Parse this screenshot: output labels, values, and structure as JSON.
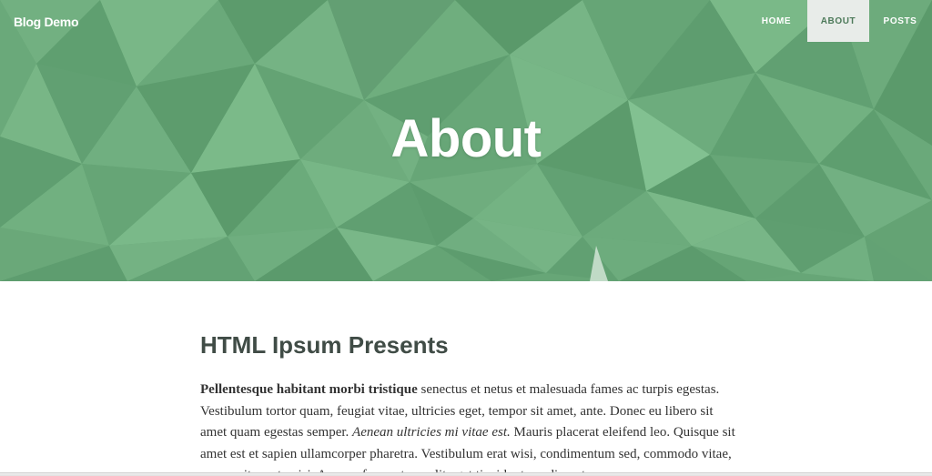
{
  "navbar": {
    "brand": "Blog Demo",
    "items": [
      {
        "label": "HOME",
        "active": false
      },
      {
        "label": "ABOUT",
        "active": true
      },
      {
        "label": "POSTS",
        "active": false
      }
    ]
  },
  "hero": {
    "title": "About",
    "background": "green low-poly pattern"
  },
  "post": {
    "heading": "HTML Ipsum Presents",
    "body": {
      "bold_lead": "Pellentesque habitant morbi tristique",
      "text_1": " senectus et netus et malesuada fames ac turpis egestas. Vestibulum tortor quam, feugiat vitae, ultricies eget, tempor sit amet, ante. Donec eu libero sit amet quam egestas semper. ",
      "italic": "Aenean ultricies mi vitae est.",
      "text_2": " Mauris placerat eleifend leo. Quisque sit amet est et sapien ullamcorper pharetra. Vestibulum erat wisi, condimentum sed, commodo vitae, ornare sit amet, wisi. Aenean fermentum, elit eget tincidunt condimentum"
    }
  },
  "colors": {
    "hero_green": "#6aa87a",
    "hero_green_dark": "#5b9a6c",
    "hero_green_light": "#7dbb8c",
    "nav_active_bg": "#e8ece9",
    "nav_active_text": "#4d7a5a",
    "heading_text": "#404c46",
    "body_text": "#333333"
  }
}
